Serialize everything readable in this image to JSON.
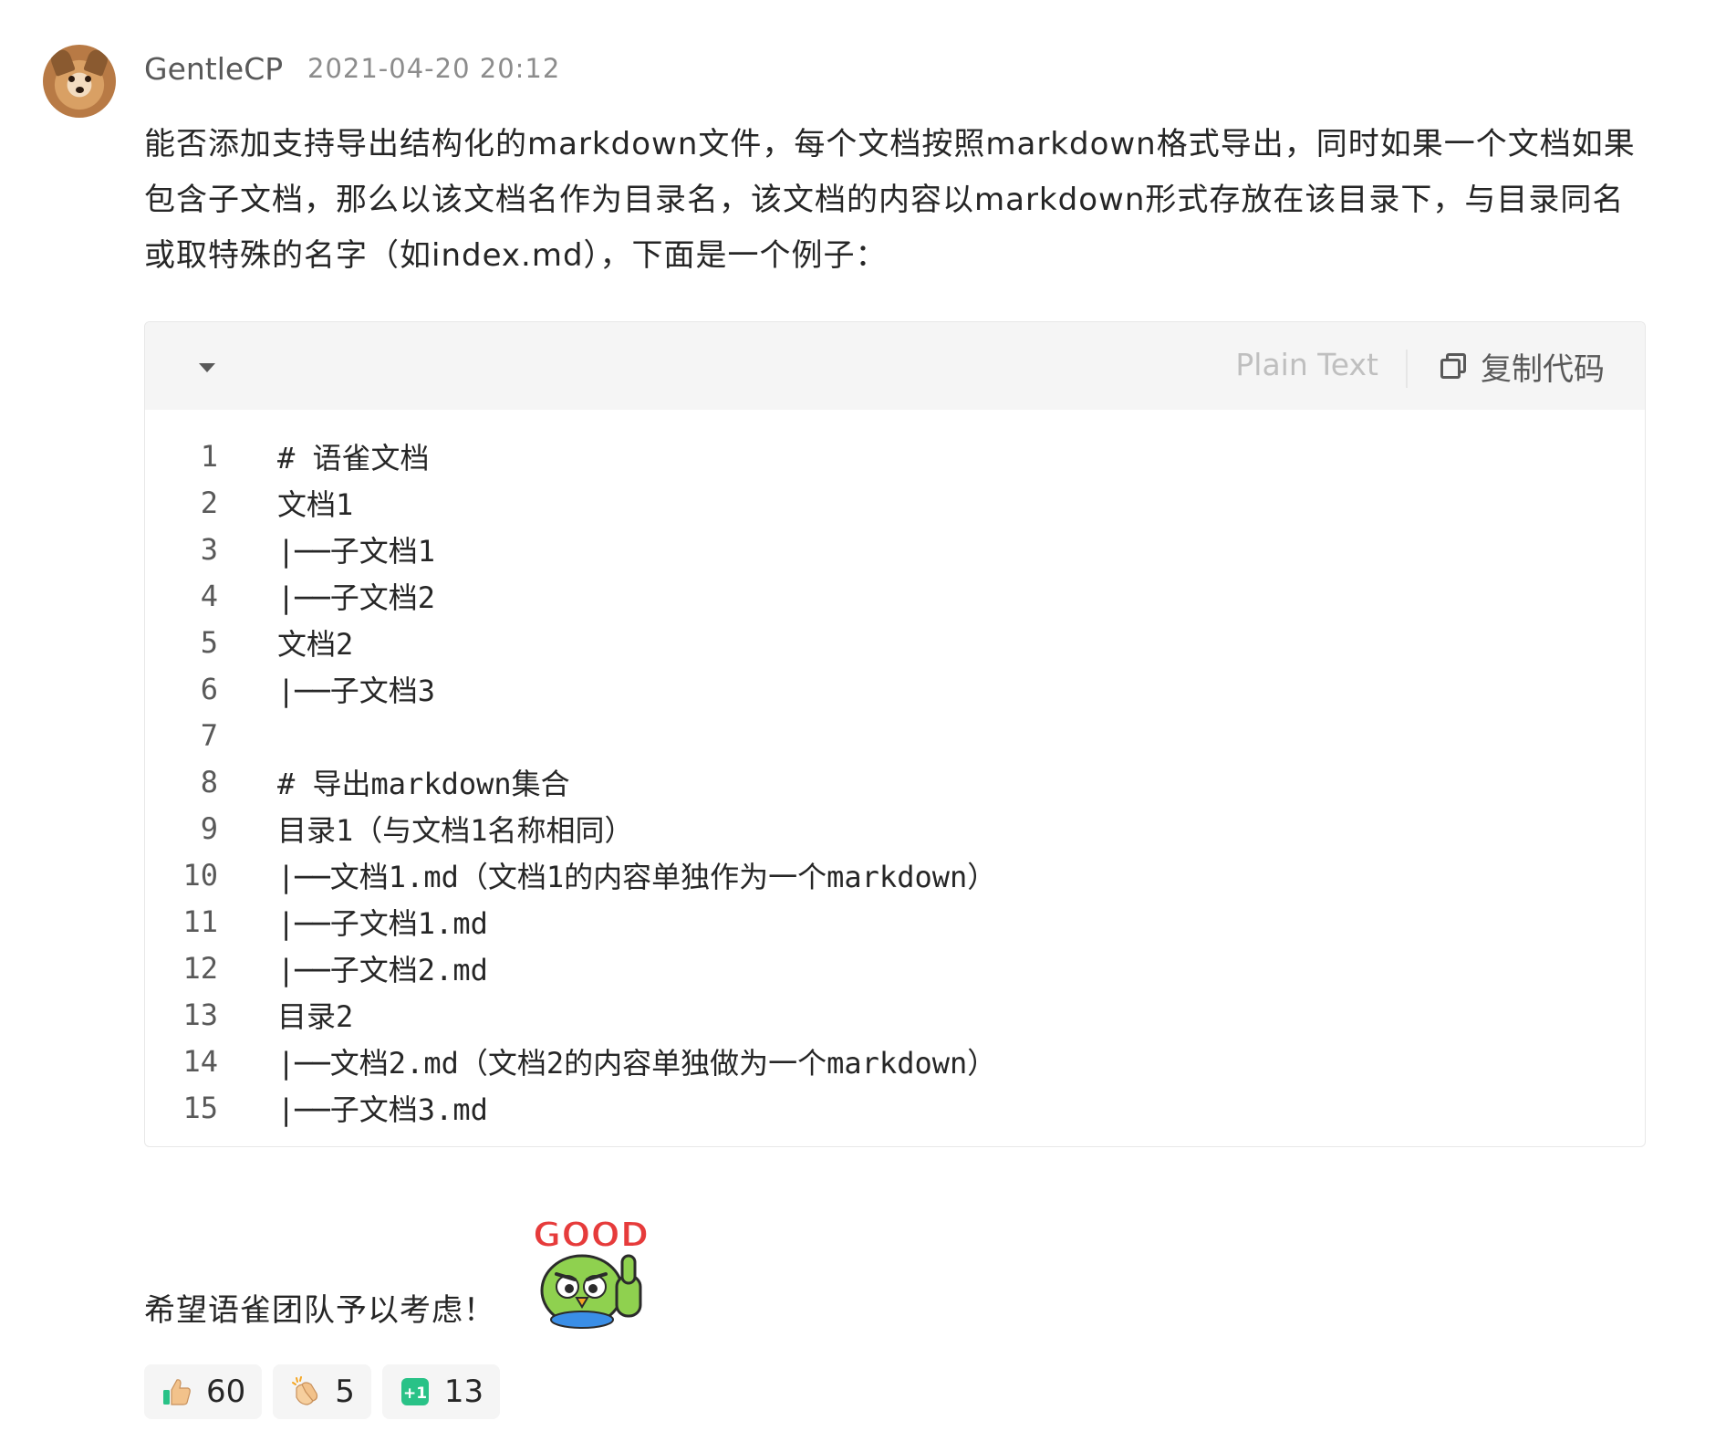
{
  "comment": {
    "author": "GentleCP",
    "timestamp": "2021-04-20 20:12",
    "body": "能否添加支持导出结构化的markdown文件，每个文档按照markdown格式导出，同时如果一个文档如果包含子文档，那么以该文档名作为目录名，该文档的内容以markdown形式存放在该目录下，与目录同名或取特殊的名字（如index.md），下面是一个例子：",
    "closing": "希望语雀团队予以考虑！"
  },
  "code_block": {
    "language": "Plain Text",
    "copy_label": "复制代码",
    "lines": [
      {
        "num": "1",
        "text": "# 语雀文档"
      },
      {
        "num": "2",
        "text": "文档1"
      },
      {
        "num": "3",
        "text": "|──子文档1"
      },
      {
        "num": "4",
        "text": "|──子文档2"
      },
      {
        "num": "5",
        "text": "文档2"
      },
      {
        "num": "6",
        "text": "|──子文档3"
      },
      {
        "num": "7",
        "text": ""
      },
      {
        "num": "8",
        "text": "# 导出markdown集合"
      },
      {
        "num": "9",
        "text": "目录1（与文档1名称相同）"
      },
      {
        "num": "10",
        "text": "|──文档1.md（文档1的内容单独作为一个markdown）"
      },
      {
        "num": "11",
        "text": "|──子文档1.md"
      },
      {
        "num": "12",
        "text": "|──子文档2.md"
      },
      {
        "num": "13",
        "text": "目录2"
      },
      {
        "num": "14",
        "text": "|──文档2.md（文档2的内容单独做为一个markdown）"
      },
      {
        "num": "15",
        "text": "|──子文档3.md"
      }
    ]
  },
  "sticker": {
    "text": "GOOD",
    "icon": "good-bird-sticker"
  },
  "reactions": [
    {
      "icon": "thumbs-up-icon",
      "count": "60"
    },
    {
      "icon": "clapping-hands-icon",
      "count": "5"
    },
    {
      "icon": "plus-one-icon",
      "label": "+1",
      "count": "13"
    }
  ],
  "colors": {
    "accent_green": "#29c287",
    "sticker_red": "#e63b3b",
    "sticker_green": "#8fd14f"
  }
}
